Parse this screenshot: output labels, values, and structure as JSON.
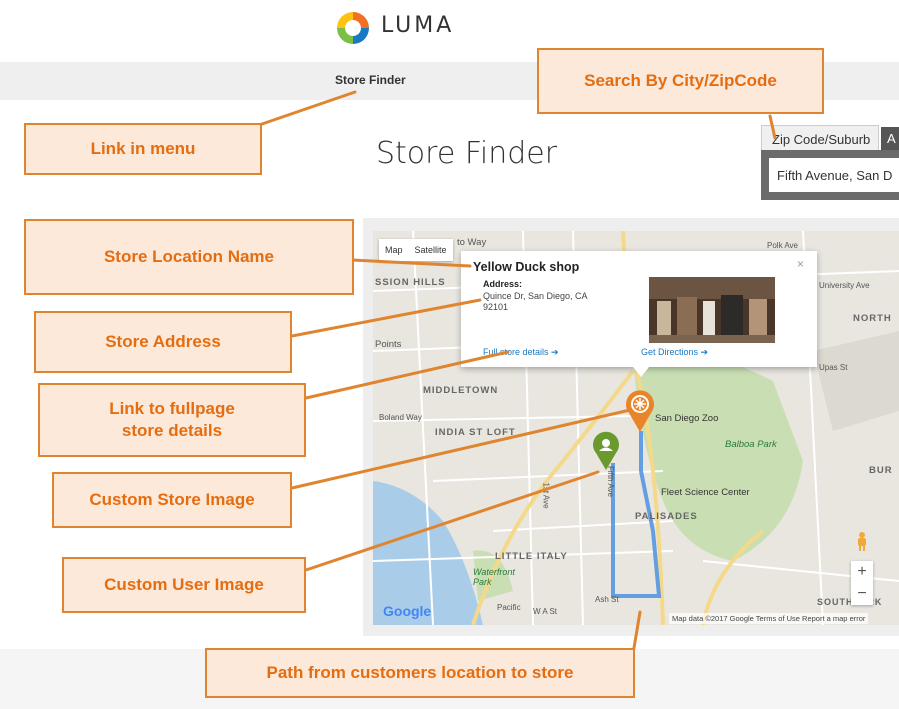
{
  "header": {
    "logo_text": "LUMA"
  },
  "nav": {
    "store_finder_link": "Store Finder"
  },
  "page": {
    "title": "Store Finder"
  },
  "search": {
    "tab_active": "Zip Code/Suburb",
    "tab_second": "A",
    "input_value": "Fifth Avenue, San Die"
  },
  "map": {
    "tab_map": "Map",
    "tab_satellite": "Satellite",
    "google_label": "Google",
    "attribution": "Map data ©2017 Google   Terms of Use   Report a map error",
    "zoom_in": "+",
    "zoom_out": "−",
    "labels": {
      "to_way": "to Way",
      "ssion_hills": "SSION HILLS",
      "points": "Points",
      "middletown": "MIDDLETOWN",
      "boland_way": "Boland Way",
      "india_st_loft": "INDIA ST LOFT",
      "san_diego_zoo": "San Diego Zoo",
      "balboa_park": "Balboa Park",
      "fleet_science": "Fleet Science Center",
      "palisades": "PALISADES",
      "little_italy": "LITTLE ITALY",
      "waterfront_park": "Waterfront Park",
      "southpark": "SOUTHPARK",
      "north": "NORTH",
      "bur": "BUR",
      "university_ave": "University Ave",
      "upas_st": "Upas St",
      "polk_ave": "Polk Ave",
      "fifth_ave": "Fifth Ave",
      "first_ave": "1st Ave",
      "ash_st": "Ash St",
      "wa_st": "W A St",
      "pacific": "Pacific"
    }
  },
  "info_window": {
    "store_name": "Yellow Duck shop",
    "close": "×",
    "address_label": "Address:",
    "address": "Quince Dr, San Diego, CA 92101",
    "full_details_link": "Full store details ➔",
    "directions_link": "Get Directions ➔"
  },
  "callouts": {
    "link_in_menu": "Link in menu",
    "search_by": "Search By City/ZipCode",
    "store_location_name": "Store Location Name",
    "store_address": "Store Address",
    "link_fullpage_line1": "Link to fullpage",
    "link_fullpage_line2": "store details",
    "custom_store_image": "Custom Store Image",
    "custom_user_image": "Custom User Image",
    "path_to_store": "Path from customers location to store"
  },
  "colors": {
    "callout_border": "#e0852f",
    "callout_fill": "#fde9d9",
    "callout_text": "#e56d11",
    "store_marker": "#e8852a",
    "user_marker": "#6a9a2e",
    "route": "#4a90e2",
    "link": "#1979c3"
  }
}
